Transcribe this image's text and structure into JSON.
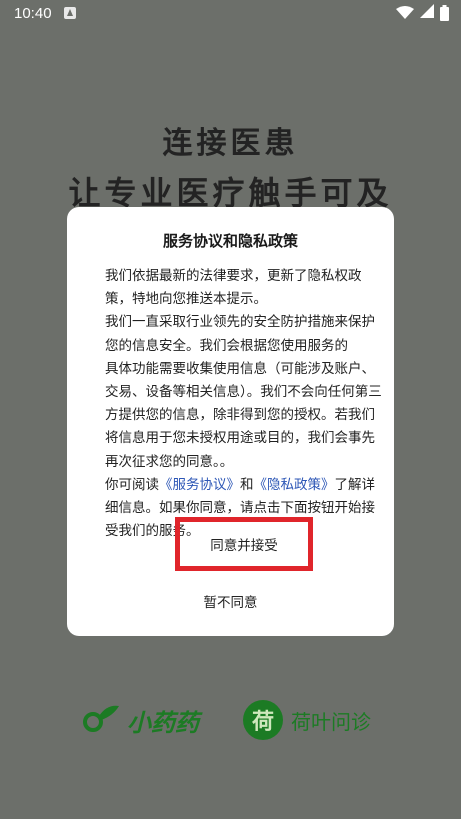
{
  "status_bar": {
    "time": "10:40"
  },
  "splash": {
    "headline_line1": "连接医患",
    "headline_line2": "让专业医疗触手可及"
  },
  "dialog": {
    "title": "服务协议和隐私政策",
    "p1": "我们依据最新的法律要求，更新了隐私权政策，特地向您推送本提示。",
    "p2a": "我们一直采取行业领先的安全防护措施来保护您的信息安全。我们会根据您使用服务的",
    "p2b": "具体功能需要收集使用信息（可能涉及账户、交易、设备等相关信息）。我们不会向任何第三方提供您的信息，除非得到您的授权。若我们将信息用于您未授权用途或目的，我们会事先再次征求您的同意。。",
    "p3_prefix": "你可阅读",
    "service_link": "《服务协议》",
    "p3_and": "和",
    "privacy_link": "《隐私政策》",
    "p3_suffix": "了解详细信息。如果你同意，请点击下面按钮开始接受我们的服务。",
    "accept_label": "同意并接受",
    "decline_label": "暂不同意"
  },
  "footer": {
    "logo_left_text": "小药药",
    "logo_right_badge": "荷",
    "logo_right_text": "荷叶问诊"
  },
  "colors": {
    "overlay": "#6c6f6a",
    "link": "#2c56b6",
    "highlight_border": "#e0252b",
    "brand_green": "#1c7b24"
  }
}
